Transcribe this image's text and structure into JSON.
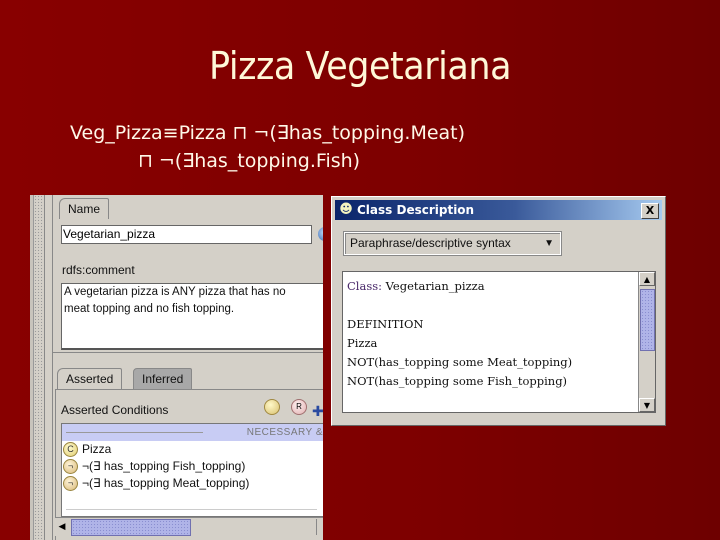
{
  "slide": {
    "title": "Pizza Vegetariana",
    "formula_line1": "Veg_Pizza≡Pizza ⊓ ¬(∃has_topping.Meat)",
    "formula_line2": "⊓ ¬(∃has_topping.Fish)"
  },
  "class_editor": {
    "name_tab": "Name",
    "name_value": "Vegetarian_pizza",
    "comment_label": "rdfs:comment",
    "comment_value": "A vegetarian pizza is ANY pizza that has no\nmeat topping and no fish topping.",
    "tabs": [
      {
        "label": "Asserted",
        "active": true
      },
      {
        "label": "Inferred",
        "active": false
      }
    ],
    "conditions_label": "Asserted Conditions",
    "toolbar_icons": [
      "create-class-icon",
      "create-restriction-icon",
      "add-named-class-icon"
    ],
    "toolbar_glyphs": {
      "restriction": "R"
    },
    "section_header": "NECESSARY &",
    "conditions": [
      {
        "badge": "C",
        "text": "Pizza"
      },
      {
        "badge": "¬",
        "text": "¬(∃ has_topping Fish_topping)"
      },
      {
        "badge": "¬",
        "text": "¬(∃ has_topping Meat_topping)"
      }
    ]
  },
  "class_description": {
    "title": "Class Description",
    "close_label": "X",
    "syntax_selected": "Paraphrase/descriptive syntax",
    "lines": [
      {
        "kw": "Class:",
        "text": " Vegetarian_pizza"
      },
      {
        "kw": "",
        "text": ""
      },
      {
        "kw": "",
        "text": "DEFINITION"
      },
      {
        "kw": "",
        "text": "Pizza"
      },
      {
        "kw": "",
        "text": "NOT(has_topping some Meat_topping)"
      },
      {
        "kw": "",
        "text": "NOT(has_topping some Fish_topping)"
      }
    ]
  }
}
